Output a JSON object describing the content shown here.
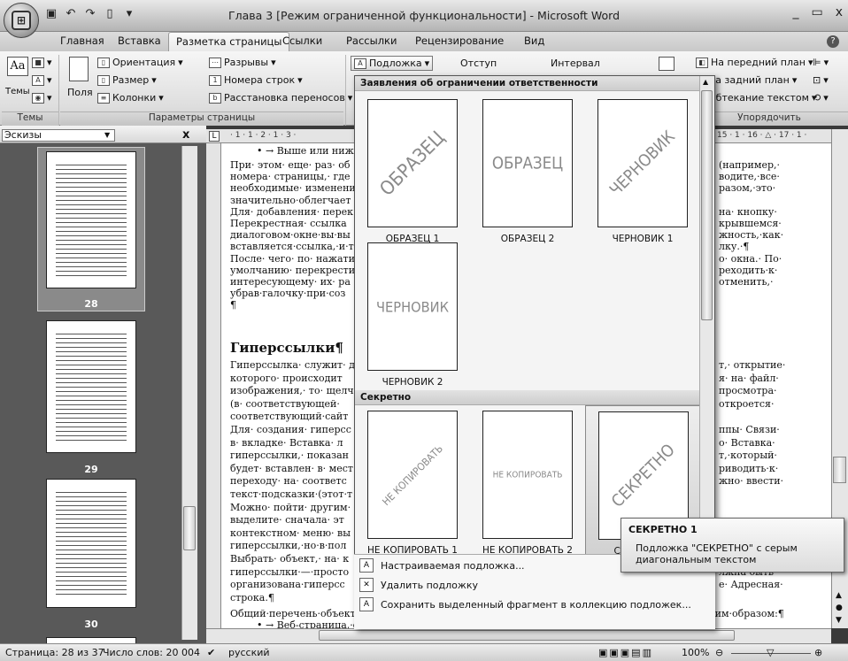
{
  "window": {
    "title": "Глава 3 [Режим ограниченной функциональности] - Microsoft Word",
    "controls": [
      "_",
      "▭",
      "x"
    ]
  },
  "tabs": [
    {
      "label": "Главная",
      "active": false
    },
    {
      "label": "Вставка",
      "active": false
    },
    {
      "label": "Разметка страницы",
      "active": true
    },
    {
      "label": "Ссылки",
      "active": false
    },
    {
      "label": "Рассылки",
      "active": false
    },
    {
      "label": "Рецензирование",
      "active": false
    },
    {
      "label": "Вид",
      "active": false
    }
  ],
  "ribbon": {
    "themes": {
      "button": "Темы",
      "group": "Темы"
    },
    "page_setup": {
      "group": "Параметры страницы",
      "fields": "Поля",
      "orientation": "Ориентация",
      "size": "Размер",
      "columns": "Колонки",
      "breaks": "Разрывы",
      "line_numbers": "Номера строк",
      "hyphenation": "Расстановка переносов"
    },
    "watermark": "Подложка",
    "indent": "Отступ",
    "spacing": "Интервал",
    "arrange": {
      "group": "Упорядочить",
      "bring_front": "На передний план",
      "send_back": "На задний план",
      "wrap": "Обтекание текстом"
    }
  },
  "thumbnails": {
    "dropdown": "Эскизы",
    "close": "x",
    "pages": [
      "28",
      "29",
      "30"
    ]
  },
  "ruler": {
    "left": "· 1 · 1 · 2 · 1 · 3 ·",
    "right": "15 · 1 · 16 · △ · 17 · 1 ·"
  },
  "document": {
    "top_bullet": "• → Выше или ниж",
    "lines_left": [
      "При· этом· еще· раз· об",
      "номера· страницы,· где",
      "необходимые· изменени",
      "значительно·облегчает",
      "Для· добавления· перек",
      "Перекрестная· ссылка",
      "диалоговом·окне·вы·вы",
      "вставляется·ссылка,·и·т",
      "После· чего· по· нажати",
      "умолчанию· перекрести",
      "интересующему· их· ра",
      "убрав·галочку·при·соз",
      "¶"
    ],
    "lines_right": [
      "(например,·",
      "водите,·все·",
      "разом,·это·",
      "",
      "на· кнопку·",
      "крывшемся·",
      "жность,·как·",
      "лку.·¶",
      "о· окна.· По·",
      "реходить·к·",
      "отменить,·",
      "",
      ""
    ],
    "heading": "Гиперссылки¶",
    "lines2_left": [
      "Гиперссылка· служит· д",
      "которого· происходит",
      "изображения,· то· щелч",
      "(в· соответствующей·",
      "соответствующий·сайт",
      "Для· создания· гиперсс",
      "в· вкладке· Вставка· л",
      "гиперссылки,· показан",
      "будет· вставлен· в· мест",
      "переходу· на· соответс",
      "текст·подсказки·(этот·т",
      "Можно· пойти· другим·",
      "выделите· сначала· эт",
      "контекстном· меню· вы",
      "гиперссылки,·но·в·пол",
      "Выбрать· объект,· на· к",
      "гиперссылки·—·просто",
      "организована·гиперсс",
      "строка.¶"
    ],
    "lines2_right": [
      "т,· открытие·",
      "я· на· файл·",
      "просмотра·",
      "откроется·",
      "",
      "ппы· Связи·",
      "о· Вставка·",
      "т,·который·",
      "риводить·к·",
      "жно· ввести·",
      "",
      "",
      "",
      "",
      "",
      "а· Вставка·",
      "лжна·быть·",
      "е· Адресная·",
      ""
    ],
    "general_line": "Общий·перечень·объектов,·с·которыми·может·быть·связана·гиперссылка,·выглядит·следующим·образом:¶",
    "bottom_bullet": "• → Веб-страница,·файл·(например,·другой·документ·Word)¶"
  },
  "gallery": {
    "category1": "Заявления об ограничении ответственности",
    "category2": "Секретно",
    "items1": [
      {
        "label": "ОБРАЗЕЦ 1",
        "text": "ОБРАЗЕЦ",
        "style": "diagonal"
      },
      {
        "label": "ОБРАЗЕЦ 2",
        "text": "ОБРАЗЕЦ",
        "style": "horizontal"
      },
      {
        "label": "ЧЕРНОВИК 1",
        "text": "ЧЕРНОВИК",
        "style": "diagonal"
      },
      {
        "label": "ЧЕРНОВИК 2",
        "text": "ЧЕРНОВИК",
        "style": "horizontal"
      }
    ],
    "items2": [
      {
        "label": "НЕ КОПИРОВАТЬ 1",
        "text": "НЕ КОПИРОВАТЬ",
        "style": "diagonal"
      },
      {
        "label": "НЕ КОПИРОВАТЬ 2",
        "text": "НЕ КОПИРОВАТЬ",
        "style": "horizontal"
      },
      {
        "label": "СЕКРЕТНО 1",
        "text": "СЕКРЕТНО",
        "style": "diagonal",
        "highlighted": true
      }
    ],
    "menu": [
      {
        "label": "Настраиваемая подложка...",
        "icon": "custom-watermark-icon"
      },
      {
        "label": "Удалить подложку",
        "icon": "remove-watermark-icon"
      },
      {
        "label": "Сохранить выделенный фрагмент в коллекцию подложек...",
        "icon": "save-to-gallery-icon"
      }
    ]
  },
  "tooltip": {
    "title": "СЕКРЕТНО 1",
    "body_line1": "Подложка \"СЕКРЕТНО\" с серым",
    "body_line2": "диагональным текстом"
  },
  "status": {
    "page": "Страница: 28 из 37",
    "words": "Число слов: 20 004",
    "language": "русский",
    "zoom": "100%"
  }
}
